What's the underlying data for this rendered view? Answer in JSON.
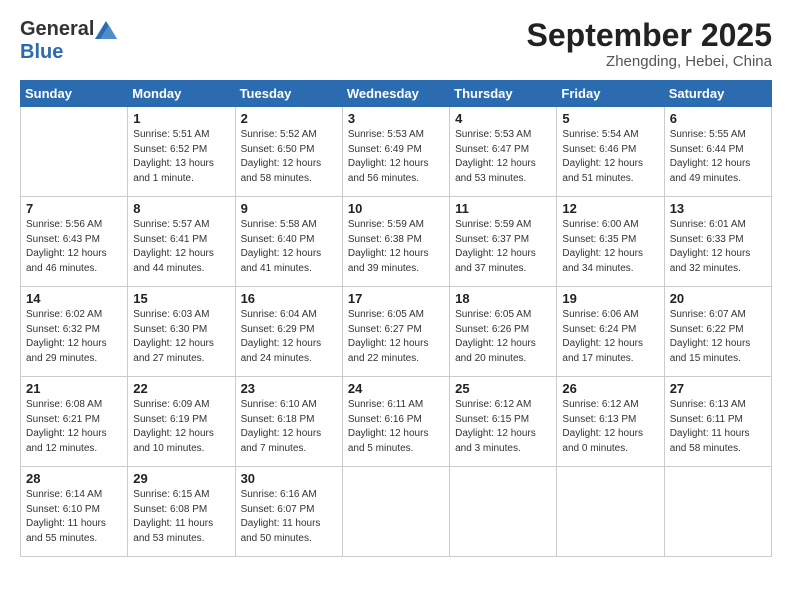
{
  "logo": {
    "general": "General",
    "blue": "Blue"
  },
  "title": "September 2025",
  "location": "Zhengding, Hebei, China",
  "days_of_week": [
    "Sunday",
    "Monday",
    "Tuesday",
    "Wednesday",
    "Thursday",
    "Friday",
    "Saturday"
  ],
  "weeks": [
    [
      {
        "day": "",
        "info": ""
      },
      {
        "day": "1",
        "info": "Sunrise: 5:51 AM\nSunset: 6:52 PM\nDaylight: 13 hours\nand 1 minute."
      },
      {
        "day": "2",
        "info": "Sunrise: 5:52 AM\nSunset: 6:50 PM\nDaylight: 12 hours\nand 58 minutes."
      },
      {
        "day": "3",
        "info": "Sunrise: 5:53 AM\nSunset: 6:49 PM\nDaylight: 12 hours\nand 56 minutes."
      },
      {
        "day": "4",
        "info": "Sunrise: 5:53 AM\nSunset: 6:47 PM\nDaylight: 12 hours\nand 53 minutes."
      },
      {
        "day": "5",
        "info": "Sunrise: 5:54 AM\nSunset: 6:46 PM\nDaylight: 12 hours\nand 51 minutes."
      },
      {
        "day": "6",
        "info": "Sunrise: 5:55 AM\nSunset: 6:44 PM\nDaylight: 12 hours\nand 49 minutes."
      }
    ],
    [
      {
        "day": "7",
        "info": "Sunrise: 5:56 AM\nSunset: 6:43 PM\nDaylight: 12 hours\nand 46 minutes."
      },
      {
        "day": "8",
        "info": "Sunrise: 5:57 AM\nSunset: 6:41 PM\nDaylight: 12 hours\nand 44 minutes."
      },
      {
        "day": "9",
        "info": "Sunrise: 5:58 AM\nSunset: 6:40 PM\nDaylight: 12 hours\nand 41 minutes."
      },
      {
        "day": "10",
        "info": "Sunrise: 5:59 AM\nSunset: 6:38 PM\nDaylight: 12 hours\nand 39 minutes."
      },
      {
        "day": "11",
        "info": "Sunrise: 5:59 AM\nSunset: 6:37 PM\nDaylight: 12 hours\nand 37 minutes."
      },
      {
        "day": "12",
        "info": "Sunrise: 6:00 AM\nSunset: 6:35 PM\nDaylight: 12 hours\nand 34 minutes."
      },
      {
        "day": "13",
        "info": "Sunrise: 6:01 AM\nSunset: 6:33 PM\nDaylight: 12 hours\nand 32 minutes."
      }
    ],
    [
      {
        "day": "14",
        "info": "Sunrise: 6:02 AM\nSunset: 6:32 PM\nDaylight: 12 hours\nand 29 minutes."
      },
      {
        "day": "15",
        "info": "Sunrise: 6:03 AM\nSunset: 6:30 PM\nDaylight: 12 hours\nand 27 minutes."
      },
      {
        "day": "16",
        "info": "Sunrise: 6:04 AM\nSunset: 6:29 PM\nDaylight: 12 hours\nand 24 minutes."
      },
      {
        "day": "17",
        "info": "Sunrise: 6:05 AM\nSunset: 6:27 PM\nDaylight: 12 hours\nand 22 minutes."
      },
      {
        "day": "18",
        "info": "Sunrise: 6:05 AM\nSunset: 6:26 PM\nDaylight: 12 hours\nand 20 minutes."
      },
      {
        "day": "19",
        "info": "Sunrise: 6:06 AM\nSunset: 6:24 PM\nDaylight: 12 hours\nand 17 minutes."
      },
      {
        "day": "20",
        "info": "Sunrise: 6:07 AM\nSunset: 6:22 PM\nDaylight: 12 hours\nand 15 minutes."
      }
    ],
    [
      {
        "day": "21",
        "info": "Sunrise: 6:08 AM\nSunset: 6:21 PM\nDaylight: 12 hours\nand 12 minutes."
      },
      {
        "day": "22",
        "info": "Sunrise: 6:09 AM\nSunset: 6:19 PM\nDaylight: 12 hours\nand 10 minutes."
      },
      {
        "day": "23",
        "info": "Sunrise: 6:10 AM\nSunset: 6:18 PM\nDaylight: 12 hours\nand 7 minutes."
      },
      {
        "day": "24",
        "info": "Sunrise: 6:11 AM\nSunset: 6:16 PM\nDaylight: 12 hours\nand 5 minutes."
      },
      {
        "day": "25",
        "info": "Sunrise: 6:12 AM\nSunset: 6:15 PM\nDaylight: 12 hours\nand 3 minutes."
      },
      {
        "day": "26",
        "info": "Sunrise: 6:12 AM\nSunset: 6:13 PM\nDaylight: 12 hours\nand 0 minutes."
      },
      {
        "day": "27",
        "info": "Sunrise: 6:13 AM\nSunset: 6:11 PM\nDaylight: 11 hours\nand 58 minutes."
      }
    ],
    [
      {
        "day": "28",
        "info": "Sunrise: 6:14 AM\nSunset: 6:10 PM\nDaylight: 11 hours\nand 55 minutes."
      },
      {
        "day": "29",
        "info": "Sunrise: 6:15 AM\nSunset: 6:08 PM\nDaylight: 11 hours\nand 53 minutes."
      },
      {
        "day": "30",
        "info": "Sunrise: 6:16 AM\nSunset: 6:07 PM\nDaylight: 11 hours\nand 50 minutes."
      },
      {
        "day": "",
        "info": ""
      },
      {
        "day": "",
        "info": ""
      },
      {
        "day": "",
        "info": ""
      },
      {
        "day": "",
        "info": ""
      }
    ]
  ]
}
